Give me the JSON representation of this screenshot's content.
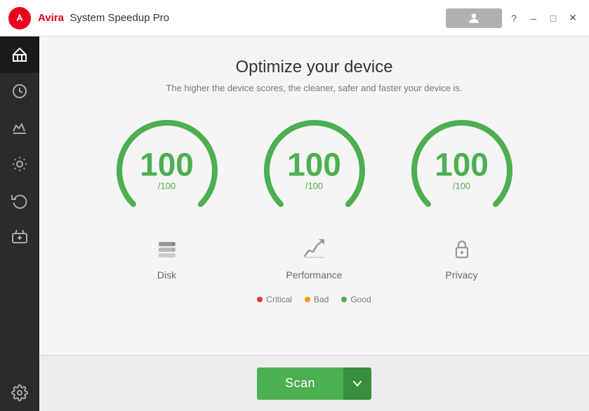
{
  "titlebar": {
    "logo_alt": "Avira logo",
    "brand": "Avira",
    "appname": "System Speedup Pro",
    "user_btn_label": "",
    "help_label": "?",
    "minimize_label": "–",
    "maximize_label": "□",
    "close_label": "✕"
  },
  "sidebar": {
    "items": [
      {
        "id": "home",
        "icon": "home-icon",
        "label": "Home"
      },
      {
        "id": "history",
        "icon": "clock-icon",
        "label": "History"
      },
      {
        "id": "optimizer",
        "icon": "optimizer-icon",
        "label": "Optimizer"
      },
      {
        "id": "cleaner",
        "icon": "cleaner-icon",
        "label": "Cleaner"
      },
      {
        "id": "recovery",
        "icon": "recovery-icon",
        "label": "Recovery"
      },
      {
        "id": "games",
        "icon": "games-icon",
        "label": "Games"
      },
      {
        "id": "settings",
        "icon": "settings-icon",
        "label": "Settings"
      }
    ]
  },
  "main": {
    "title": "Optimize your device",
    "subtitle": "The higher the device scores, the cleaner, safer and faster your device is.",
    "gauges": [
      {
        "id": "disk",
        "score": "100",
        "max": "/100",
        "label": "Disk",
        "icon": "disk-icon"
      },
      {
        "id": "performance",
        "score": "100",
        "max": "/100",
        "label": "Performance",
        "icon": "performance-icon"
      },
      {
        "id": "privacy",
        "score": "100",
        "max": "/100",
        "label": "Privacy",
        "icon": "privacy-icon"
      }
    ],
    "legend": [
      {
        "label": "Critical",
        "color": "#e53935"
      },
      {
        "label": "Bad",
        "color": "#ff9800"
      },
      {
        "label": "Good",
        "color": "#4caf50"
      }
    ],
    "scan_label": "Scan",
    "scan_dropdown_icon": "chevron-down-icon"
  }
}
